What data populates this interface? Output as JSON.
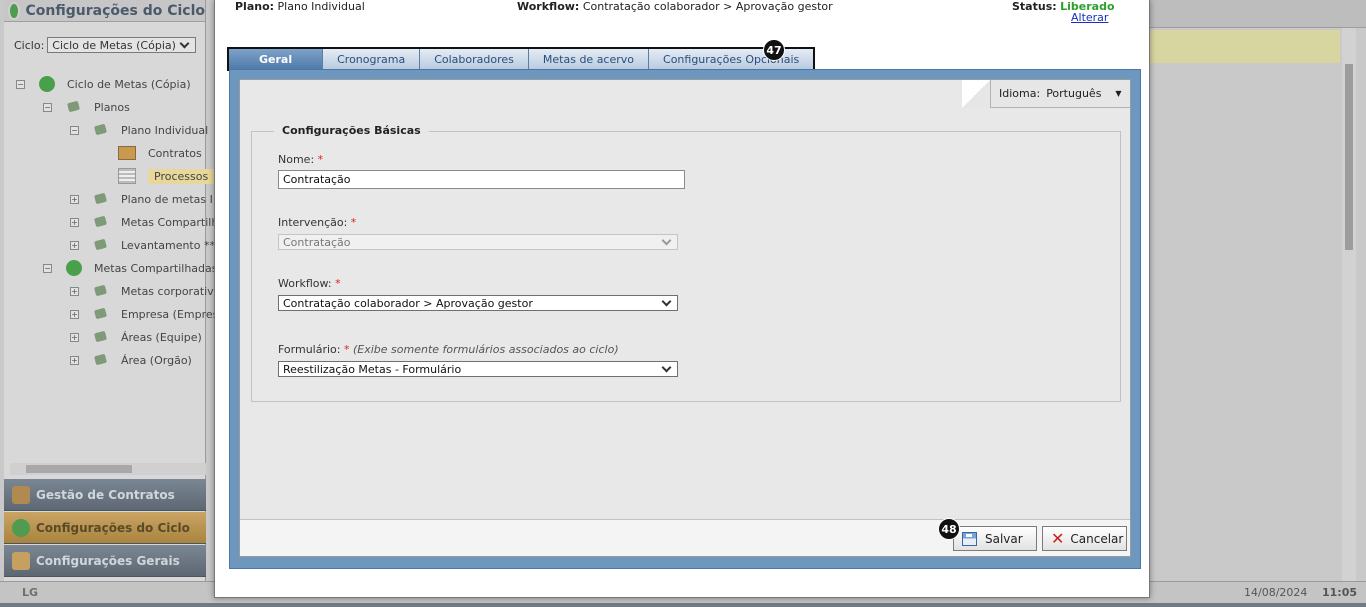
{
  "background": {
    "panel_title": "Configurações do Ciclo",
    "cycle_label": "Ciclo:",
    "cycle_value": "Ciclo de Metas (Cópia)",
    "tree": [
      {
        "label": "Ciclo de Metas (Cópia)",
        "toggle": "−",
        "icon": "cycle-icon"
      },
      {
        "label": "Planos",
        "toggle": "−",
        "icon": "leaf-icon"
      },
      {
        "label": "Plano Individual",
        "toggle": "−",
        "icon": "leaf-icon"
      },
      {
        "label": "Contratos",
        "toggle": "",
        "icon": "contract-icon"
      },
      {
        "label": "Processos",
        "toggle": "",
        "icon": "document-icon",
        "selected": true
      },
      {
        "label": "Plano de metas I",
        "toggle": "+",
        "icon": "leaf-icon"
      },
      {
        "label": "Metas Compartilh",
        "toggle": "+",
        "icon": "leaf-icon"
      },
      {
        "label": "Levantamento **",
        "toggle": "+",
        "icon": "leaf-icon"
      },
      {
        "label": "Metas Compartilhadas",
        "toggle": "−",
        "icon": "share-icon"
      },
      {
        "label": "Metas corporativa",
        "toggle": "+",
        "icon": "leaf-icon"
      },
      {
        "label": "Empresa (Empres",
        "toggle": "+",
        "icon": "leaf-icon"
      },
      {
        "label": "Áreas (Equipe)",
        "toggle": "+",
        "icon": "leaf-icon"
      },
      {
        "label": "Área (Orgão)",
        "toggle": "+",
        "icon": "leaf-icon"
      }
    ],
    "nav": [
      {
        "label": "Gestão de Contratos",
        "active": false
      },
      {
        "label": "Configurações do Ciclo",
        "active": true
      },
      {
        "label": "Configurações Gerais",
        "active": false
      }
    ],
    "status_bar": {
      "logo": "LG",
      "date": "14/08/2024",
      "time": "11:05"
    }
  },
  "modal": {
    "info": {
      "plan_label": "Plano:",
      "plan_value": "Plano Individual",
      "workflow_label": "Workflow:",
      "workflow_value": "Contratação colaborador > Aprovação gestor",
      "status_label": "Status:",
      "status_value": "Liberado",
      "change_link": "Alterar"
    },
    "tabs": [
      {
        "label": "Geral",
        "active": true
      },
      {
        "label": "Cronograma",
        "active": false
      },
      {
        "label": "Colaboradores",
        "active": false
      },
      {
        "label": "Metas de acervo",
        "active": false
      },
      {
        "label": "Configurações Opcionais",
        "active": false
      }
    ],
    "markers": {
      "tabs": "47",
      "save": "48"
    },
    "language": {
      "label": "Idioma:",
      "value": "Português"
    },
    "section_title": "Configurações Básicas",
    "fields": {
      "name": {
        "label": "Nome:",
        "required": "*",
        "value": "Contratação"
      },
      "intervention": {
        "label": "Intervenção:",
        "required": "*",
        "value": "Contratação"
      },
      "workflow": {
        "label": "Workflow:",
        "required": "*",
        "value": "Contratação colaborador > Aprovação gestor"
      },
      "form": {
        "label": "Formulário:",
        "required": "*",
        "hint": "(Exibe somente formulários associados ao ciclo)",
        "value": "Reestilização Metas - Formulário"
      }
    },
    "buttons": {
      "save": "Salvar",
      "cancel": "Cancelar"
    }
  },
  "colors": {
    "accent_blue": "#4f7aab",
    "status_green": "#2ca02c",
    "required_red": "#dd2222"
  }
}
